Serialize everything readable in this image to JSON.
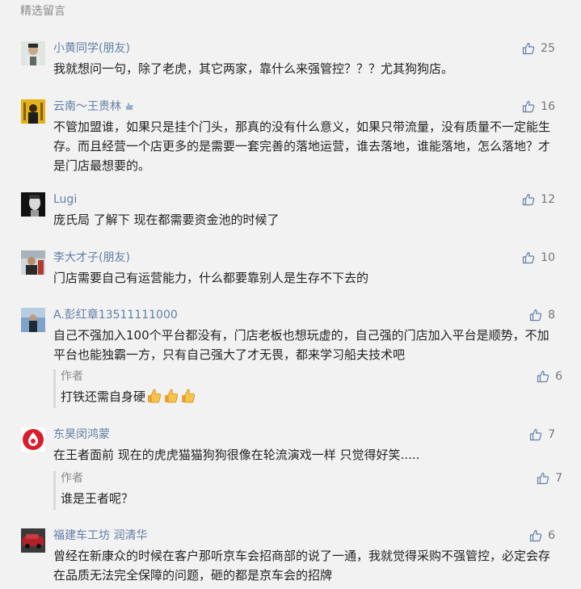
{
  "section": {
    "title": "精选留言"
  },
  "comments": [
    {
      "nickname": "小黄同学(朋友)",
      "likes": "25",
      "text": "我就想问一句，除了老虎，其它两家，靠什么来强管控？？？尤其狗狗店。"
    },
    {
      "nickname": "云南～王贵林",
      "likes": "16",
      "text": "不管加盟谁，如果只是挂个门头，那真的没有什么意义，如果只带流量，没有质量不一定能生存。而且经营一个店更多的是需要一套完善的落地运营，谁去落地，谁能落地，怎么落地？才是门店最想要的。"
    },
    {
      "nickname": "Lugi",
      "likes": "12",
      "text": "庞氏局 了解下 现在都需要资金池的时候了"
    },
    {
      "nickname": "李大才子(朋友)",
      "likes": "10",
      "text": "门店需要自己有运营能力，什么都要靠别人是生存不下去的"
    },
    {
      "nickname": "A.彭红章13511111000",
      "likes": "8",
      "text": "自己不强加入100个平台都没有，门店老板也想玩虚的，自己强的门店加入平台是顺势，不加平台也能独霸一方，只有自己强大了才无畏，都来学习船夫技术吧",
      "reply": {
        "author": "作者",
        "likes": "6",
        "text": "打铁还需自身硬"
      }
    },
    {
      "nickname": "东昊闵鸿蒙",
      "likes": "7",
      "text": "在王者面前 现在的虎虎猫猫狗狗很像在轮流演戏一样 只觉得好笑.....",
      "reply": {
        "author": "作者",
        "likes": "7",
        "text": "谁是王者呢？"
      }
    },
    {
      "nickname": "福建车工坊 润清华",
      "likes": "6",
      "text": "曾经在新康众的时候在客户那听京车会招商部的说了一通，我就觉得采购不强管控，必定会存在品质无法完全保障的问题，砸的都是京车会的招牌"
    }
  ],
  "colors": {
    "background": "#f2f2f2",
    "nickname": "#607fa6",
    "meta": "#888888",
    "text": "#222222"
  }
}
